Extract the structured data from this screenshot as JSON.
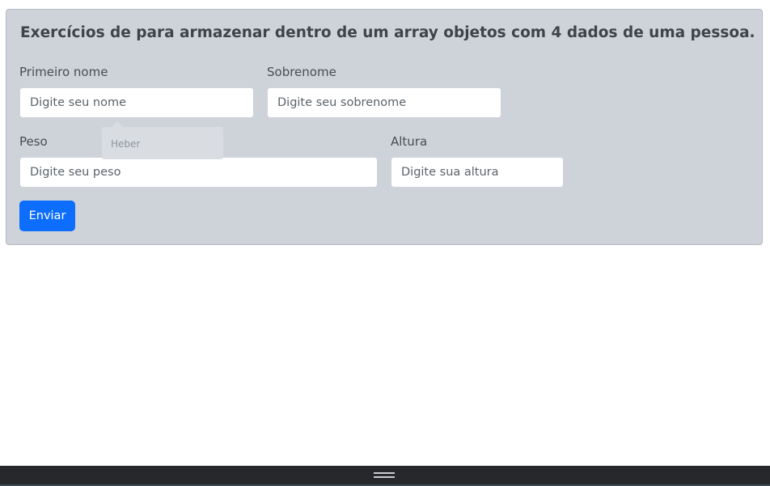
{
  "form": {
    "title": "Exercícios de para armazenar dentro de um array objetos com 4 dados de uma pessoa.",
    "fields": {
      "first_name": {
        "label": "Primeiro nome",
        "placeholder": "Digite seu nome",
        "value": ""
      },
      "last_name": {
        "label": "Sobrenome",
        "placeholder": "Digite seu sobrenome",
        "value": ""
      },
      "weight": {
        "label": "Peso",
        "placeholder": "Digite seu peso",
        "value": ""
      },
      "height": {
        "label": "Altura",
        "placeholder": "Digite sua altura",
        "value": ""
      }
    },
    "autofill": {
      "options": [
        "Heber"
      ]
    },
    "submit_label": "Enviar"
  },
  "colors": {
    "card_background": "#ced3da",
    "primary_button": "#0d6efd",
    "bottom_bar": "#26282c"
  },
  "icons": {
    "bottom_bar_handle": "drag-handle-icon"
  }
}
